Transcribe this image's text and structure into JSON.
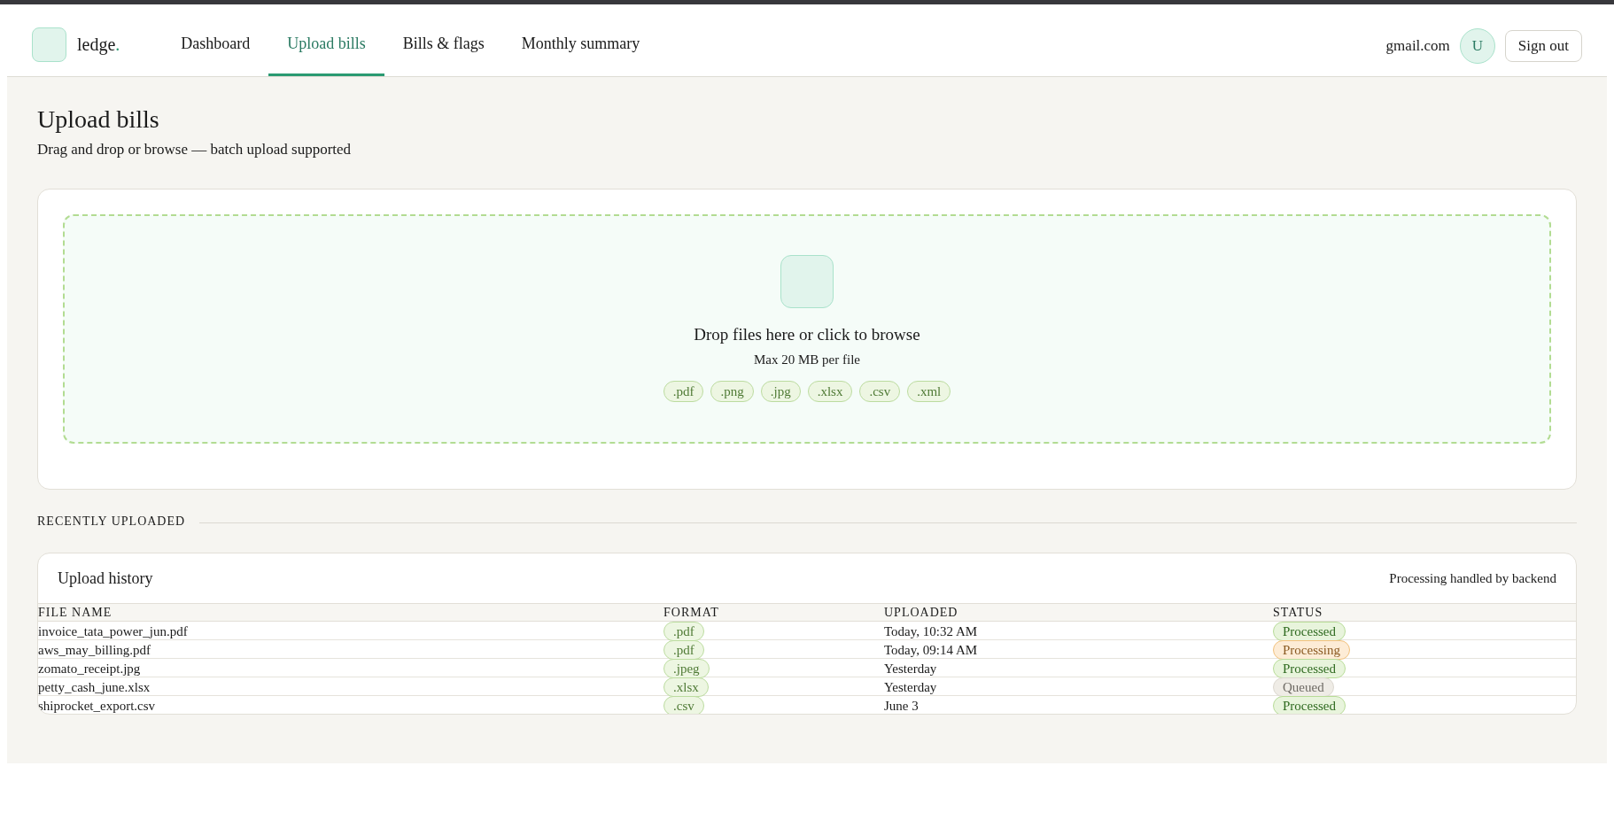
{
  "header": {
    "logo": {
      "name": "ledge",
      "mark": "."
    },
    "nav": [
      {
        "label": "Dashboard",
        "selected": false
      },
      {
        "label": "Upload bills",
        "selected": true
      },
      {
        "label": "Bills & flags",
        "selected": false
      },
      {
        "label": "Monthly summary",
        "selected": false
      }
    ],
    "account": {
      "email": "gmail.com",
      "avatar_initial": "U"
    },
    "sign_out": "Sign out"
  },
  "page": {
    "title": "Upload bills",
    "subtitle": "Drag and drop or browse — batch upload supported"
  },
  "dropzone": {
    "prompt": "Drop files here or click to browse",
    "limit": "Max 20 MB per file",
    "formats": [
      ".pdf",
      ".png",
      ".jpg",
      ".xlsx",
      ".csv",
      ".xml"
    ]
  },
  "recent": {
    "heading": "RECENTLY UPLOADED",
    "card_title": "Upload history",
    "note": "Processing handled by backend",
    "table": {
      "columns": [
        "FILE NAME",
        "FORMAT",
        "UPLOADED",
        "STATUS"
      ],
      "rows": [
        {
          "file_name": "invoice_tata_power_jun.pdf",
          "format": ".pdf",
          "uploaded": "Today, 10:32 AM",
          "status": {
            "label": "Processed",
            "kind": "processed"
          }
        },
        {
          "file_name": "aws_may_billing.pdf",
          "format": ".pdf",
          "uploaded": "Today, 09:14 AM",
          "status": {
            "label": "Processing",
            "kind": "processing"
          }
        },
        {
          "file_name": "zomato_receipt.jpg",
          "format": ".jpeg",
          "uploaded": "Yesterday",
          "status": {
            "label": "Processed",
            "kind": "processed"
          }
        },
        {
          "file_name": "petty_cash_june.xlsx",
          "format": ".xlsx",
          "uploaded": "Yesterday",
          "status": {
            "label": "Queued",
            "kind": "queued"
          }
        },
        {
          "file_name": "shiprocket_export.csv",
          "format": ".csv",
          "uploaded": "June 3",
          "status": {
            "label": "Processed",
            "kind": "processed"
          }
        }
      ]
    }
  }
}
